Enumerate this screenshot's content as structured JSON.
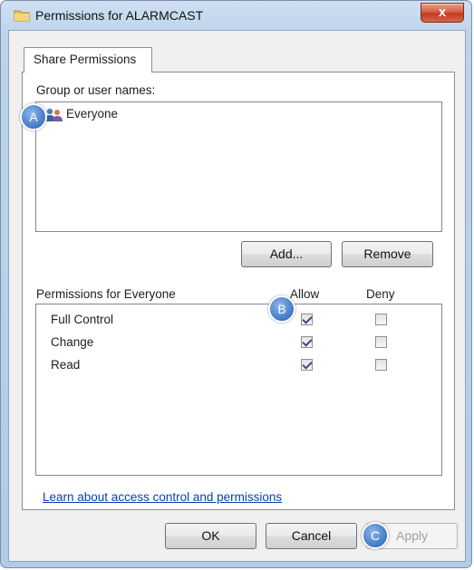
{
  "window": {
    "title": "Permissions for ALARMCAST",
    "close_label": "x"
  },
  "tabs": [
    {
      "label": "Share Permissions"
    }
  ],
  "group_section": {
    "label": "Group or user names:",
    "users": [
      {
        "name": "Everyone"
      }
    ],
    "add_label": "Add...",
    "remove_label": "Remove"
  },
  "permissions_section": {
    "label": "Permissions for Everyone",
    "allow_header": "Allow",
    "deny_header": "Deny",
    "rows": [
      {
        "name": "Full Control",
        "allow": true,
        "deny": false
      },
      {
        "name": "Change",
        "allow": true,
        "deny": false
      },
      {
        "name": "Read",
        "allow": true,
        "deny": false
      }
    ]
  },
  "help_link": "Learn about access control and permissions",
  "footer": {
    "ok_label": "OK",
    "cancel_label": "Cancel",
    "apply_label": "Apply",
    "apply_enabled": false
  },
  "callouts": {
    "a": "A",
    "b": "B",
    "c": "C"
  },
  "colors": {
    "link": "#0b3fae",
    "callout": "#4f84cf",
    "close": "#c23a1e"
  }
}
